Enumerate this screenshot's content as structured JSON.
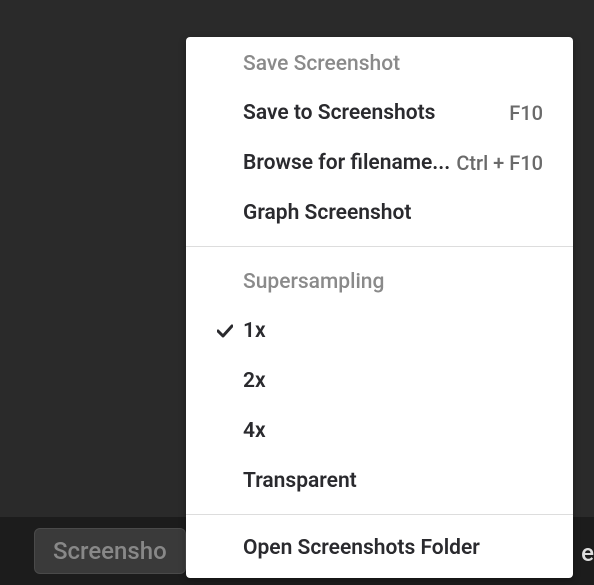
{
  "bottomBar": {
    "buttonLabel": "Screensho",
    "rightText": "e"
  },
  "menu": {
    "section1": {
      "header": "Save Screenshot",
      "items": [
        {
          "label": "Save to Screenshots",
          "shortcut": "F10"
        },
        {
          "label": "Browse for filename...",
          "shortcut": "Ctrl + F10"
        },
        {
          "label": "Graph Screenshot",
          "shortcut": ""
        }
      ]
    },
    "section2": {
      "header": "Supersampling",
      "items": [
        {
          "label": "1x",
          "checked": true
        },
        {
          "label": "2x",
          "checked": false
        },
        {
          "label": "4x",
          "checked": false
        },
        {
          "label": "Transparent",
          "checked": false
        }
      ]
    },
    "section3": {
      "items": [
        {
          "label": "Open Screenshots Folder"
        }
      ]
    }
  }
}
